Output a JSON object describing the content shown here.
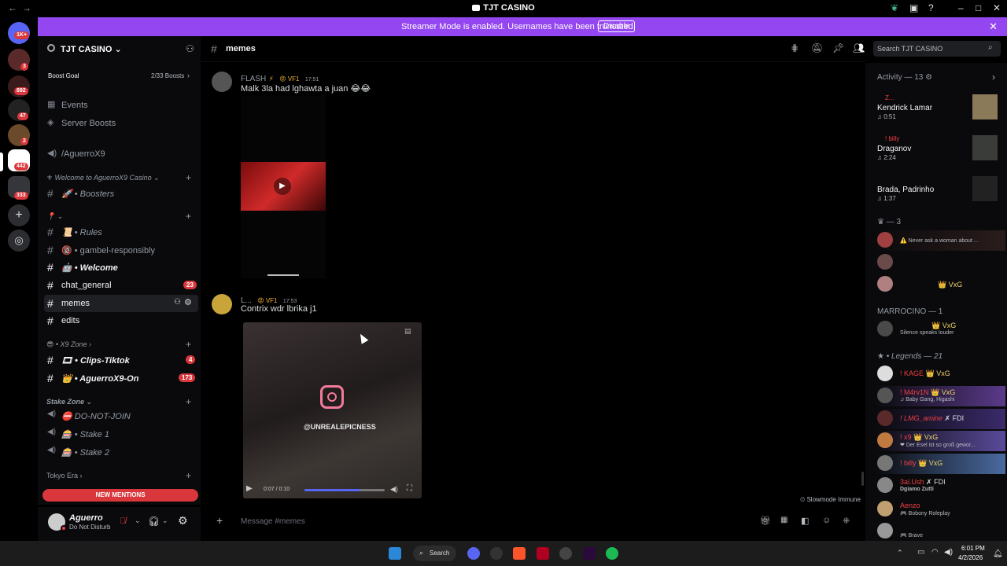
{
  "window": {
    "title": "TJT CASINO"
  },
  "banner": {
    "text": "Streamer Mode is enabled. Usernames have been truncated.",
    "button": "Disable"
  },
  "guild_badges": [
    "1K+",
    "3",
    "892",
    "47",
    "2",
    "442",
    "333"
  ],
  "server": {
    "name": "TJT CASINO"
  },
  "boost": {
    "label": "Boost Goal",
    "progress": "2/33 Boosts"
  },
  "sidebar": {
    "events": "Events",
    "server_boosts": "Server Boosts",
    "voice_top": "/AguerroX9",
    "categories": {
      "welcome": "Welcome to AguerroX9 Casino",
      "x9zone": "X9 Zone",
      "stake": "Stake Zone",
      "tokyo": "Tokyo Era"
    },
    "channels": {
      "boosters": "Boosters",
      "rules": "Rules",
      "gambel": "gambel-responsibly",
      "welcome": "Welcome",
      "chat_general": "chat_general",
      "chat_general_badge": "23",
      "memes": "memes",
      "edits": "edits",
      "clips": "Clips-Tiktok",
      "clips_badge": "4",
      "aguerro_on": "AguerroX9-On",
      "aguerro_on_badge": "173",
      "donotjoin": "DO-NOT-JOIN",
      "stake1": "Stake 1",
      "stake2": "Stake 2"
    },
    "new_mentions": "NEW MENTIONS"
  },
  "user": {
    "name": "Aguerro",
    "status": "Do Not Disturb"
  },
  "channel": {
    "name": "memes",
    "search_placeholder": "Search TJT CASINO"
  },
  "messages": [
    {
      "author": "FLASH",
      "tag": "VF1",
      "time": "17:51",
      "text": "Malk 3la had lghawta a juan 😂😂"
    },
    {
      "author": "L...",
      "tag": "VF1",
      "time": "17:53",
      "text": "Contrix wdr lbrika j1"
    }
  ],
  "video": {
    "watermark": "@UNREALEPICNESS",
    "time": "0:07 / 0:10"
  },
  "slowmode": "Slowmode Immune",
  "composer": {
    "placeholder": "Message #memes"
  },
  "members": {
    "activity_header": "Activity — 13",
    "activities": [
      {
        "title": "Kendrick Lamar",
        "time": "0:51",
        "user": "Z..."
      },
      {
        "title": "Draganov",
        "time": "2:24",
        "user": "! billy"
      },
      {
        "title": "Brada, Padrinho",
        "time": "1:37",
        "user": ""
      }
    ],
    "group1_header": "— 3",
    "group1": [
      {
        "name": "",
        "status": "⚠️ Never ask a woman about ..."
      },
      {
        "name": "",
        "status": ""
      },
      {
        "name": "",
        "tag": "VxG",
        "status": ""
      }
    ],
    "group2_header": "MARROCINO — 1",
    "group2": [
      {
        "name": "",
        "tag": "VxG",
        "status": "Silence speaks louder"
      }
    ],
    "group3_header": "Legends — 21",
    "group3": [
      {
        "name": "! KAGE",
        "tag": "VxG",
        "status": ""
      },
      {
        "name": "! M4rv1N",
        "tag": "VxG",
        "status": "Baby Gang, Higashi"
      },
      {
        "name": "! LMG_amine",
        "tag": "FDI",
        "status": ""
      },
      {
        "name": "! x9",
        "tag": "VxG",
        "status": "Der Esel ist so groß gewor..."
      },
      {
        "name": "! billy",
        "tag": "VxG",
        "status": ""
      },
      {
        "name": "3al.Ush",
        "tag": "FDI",
        "status": "Dgiamo Zutti"
      },
      {
        "name": "Aenzo",
        "tag": "",
        "status": "Bobony Roleplay"
      },
      {
        "name": "",
        "tag": "",
        "status": "Brave"
      }
    ]
  },
  "taskbar": {
    "search": "Search",
    "time": "6:01 PM",
    "date": "4/2/2026"
  },
  "colors": {
    "accent": "#9447f0",
    "danger": "#da373c",
    "background": "#000000"
  }
}
